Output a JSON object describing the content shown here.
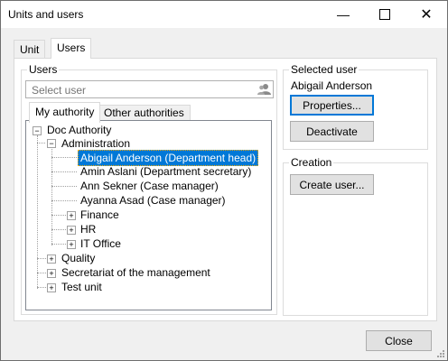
{
  "window": {
    "title": "Units and users"
  },
  "tabs": [
    {
      "label": "Unit"
    },
    {
      "label": "Users"
    }
  ],
  "users_group": {
    "title": "Users",
    "search_placeholder": "Select user",
    "subtabs": [
      {
        "label": "My authority"
      },
      {
        "label": "Other authorities"
      }
    ],
    "tree": {
      "root": "Doc Authority",
      "administration": "Administration",
      "people": [
        "Abigail Anderson (Department head)",
        "Amin Aslani (Department secretary)",
        "Ann Sekner (Case manager)",
        "Ayanna Asad (Case manager)"
      ],
      "subunits": [
        "Finance",
        "HR",
        "IT Office"
      ],
      "top_units": [
        "Quality",
        "Secretariat of the management",
        "Test unit"
      ]
    }
  },
  "selected_user": {
    "title": "Selected user",
    "name": "Abigail Anderson",
    "properties_label": "Properties...",
    "deactivate_label": "Deactivate"
  },
  "creation": {
    "title": "Creation",
    "create_label": "Create user..."
  },
  "footer": {
    "close_label": "Close"
  }
}
